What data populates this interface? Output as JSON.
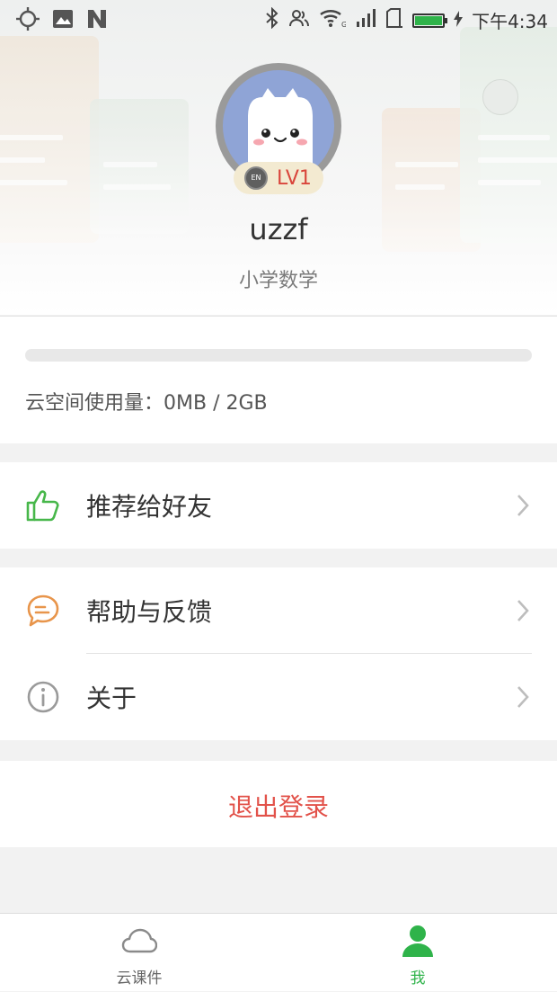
{
  "status_bar": {
    "time": "下午4:34",
    "battery_level": 1.0,
    "icons": [
      "crosshair-icon",
      "image-icon",
      "n-icon",
      "bluetooth-icon",
      "contacts-icon",
      "wifi-icon",
      "signal-icon",
      "sim-icon",
      "battery-icon"
    ]
  },
  "profile": {
    "username": "uzzf",
    "subject": "小学数学",
    "level": "LV1",
    "medal_text": "EN"
  },
  "storage": {
    "label": "云空间使用量：0MB / 2GB",
    "used_fraction": 0.0
  },
  "menu": {
    "recommend": "推荐给好友",
    "help": "帮助与反馈",
    "about": "关于",
    "logout": "退出登录"
  },
  "tabs": [
    {
      "label": "云课件",
      "icon": "cloud-icon",
      "active": false
    },
    {
      "label": "我",
      "icon": "person-icon",
      "active": true
    }
  ],
  "colors": {
    "accent": "#2fb34a",
    "danger": "#e2524a",
    "feedback_icon": "#e8954b",
    "level_text": "#d9453b"
  }
}
